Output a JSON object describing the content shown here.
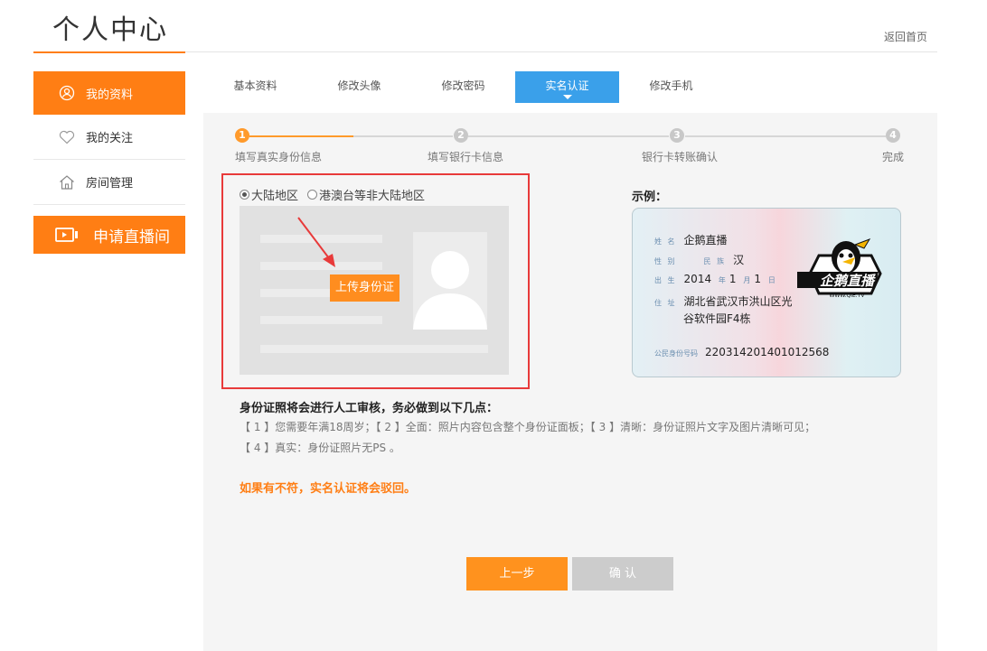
{
  "header": {
    "title": "个人中心",
    "back_home": "返回首页"
  },
  "sidebar": {
    "items": [
      {
        "label": "我的资料",
        "icon": "user-icon",
        "active": true
      },
      {
        "label": "我的关注",
        "icon": "heart-icon",
        "active": false
      },
      {
        "label": "房间管理",
        "icon": "house-icon",
        "active": false
      }
    ],
    "live_button": {
      "label": "申请直播间",
      "icon": "video-camera-icon"
    }
  },
  "tabs": [
    {
      "label": "基本资料",
      "active": false
    },
    {
      "label": "修改头像",
      "active": false
    },
    {
      "label": "修改密码",
      "active": false
    },
    {
      "label": "实名认证",
      "active": true
    },
    {
      "label": "修改手机",
      "active": false
    }
  ],
  "steps": [
    {
      "number": "1",
      "label": "填写真实身份信息",
      "active": true
    },
    {
      "number": "2",
      "label": "填写银行卡信息",
      "active": false
    },
    {
      "number": "3",
      "label": "银行卡转账确认",
      "active": false
    },
    {
      "number": "4",
      "label": "完成",
      "active": false
    }
  ],
  "upload": {
    "region_options": [
      {
        "label": "大陆地区",
        "selected": true
      },
      {
        "label": "港澳台等非大陆地区",
        "selected": false
      }
    ],
    "button_label": "上传身份证"
  },
  "example": {
    "label": "示例：",
    "card": {
      "name_key": "姓 名",
      "name": "企鹅直播",
      "sex_key": "性 别",
      "ethnicity_key": "民 族",
      "ethnicity": "汉",
      "birth_key": "出 生",
      "birth_year": "2014",
      "year_unit": "年",
      "birth_month": "1",
      "month_unit": "月",
      "birth_day": "1",
      "day_unit": "日",
      "address_key": "住 址",
      "address_line1": "湖北省武汉市洪山区光",
      "address_line2": "谷软件园F4栋",
      "id_key": "公民身份号码",
      "id_number": "220314201401012568",
      "logo_text": "企鹅直播",
      "logo_url": "WWW.QIE.TV"
    }
  },
  "notice": {
    "title": "身份证照将会进行人工审核，务必做到以下几点：",
    "line1": "【 1 】您需要年满18周岁；【 2 】全面：照片内容包含整个身份证面板；【 3 】清晰：身份证照片文字及图片清晰可见；",
    "line2": "【 4 】真实：身份证照片无PS 。",
    "warning": "如果有不符，实名认证将会驳回。"
  },
  "buttons": {
    "prev": "上一步",
    "confirm": "确 认"
  },
  "colors": {
    "accent": "#ff7e14",
    "tab_active": "#3aa0ea",
    "highlight_border": "#e83a3a",
    "disabled": "#cccccc"
  }
}
